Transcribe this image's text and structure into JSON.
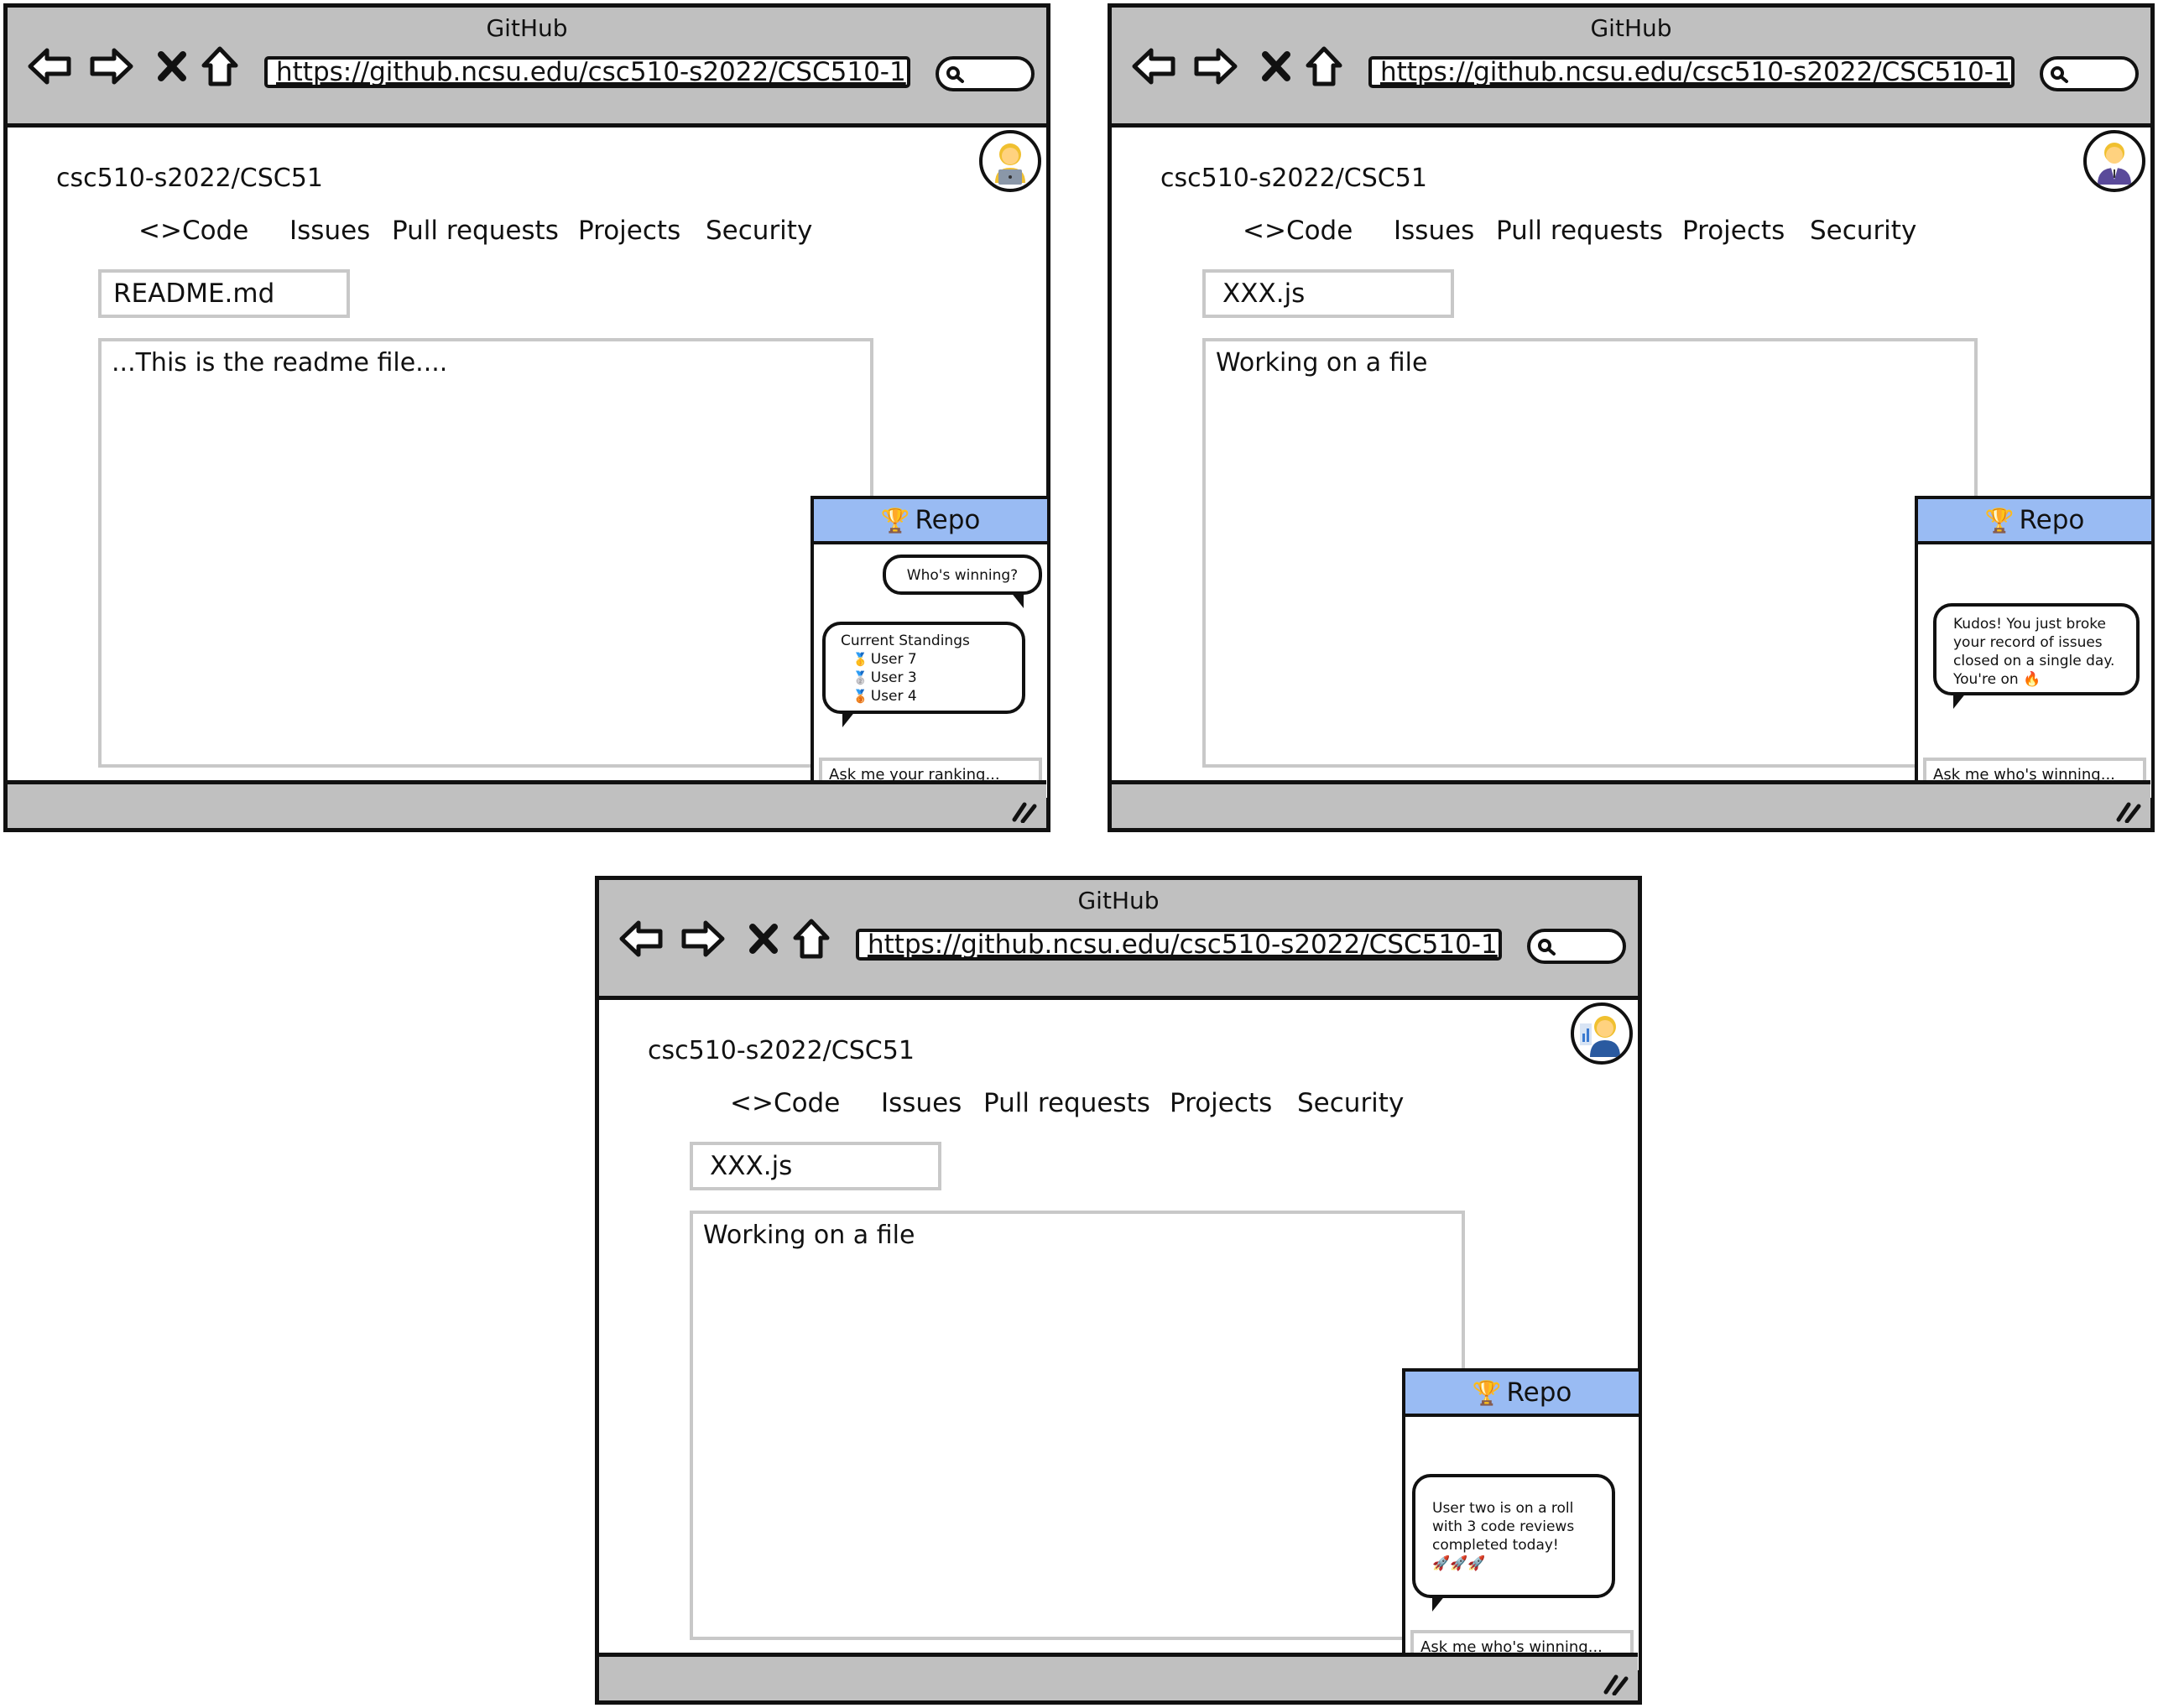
{
  "windows": [
    {
      "title": "GitHub",
      "url": "https://github.ncsu.edu/csc510-s2022/CSC510-1",
      "avatar_icon": "woman-technologist-icon",
      "repo": "csc510-s2022/CSC51",
      "tabs": [
        "<>Code",
        "Issues",
        "Pull requests",
        "Projects",
        "Security"
      ],
      "file_tab": "README.md",
      "content": "...This is the readme file....",
      "chat": {
        "header": "Repo",
        "user_message": "Who's winning?",
        "bot_title": "Current Standings",
        "standings": [
          "User 7",
          "User 3",
          "User 4"
        ],
        "input_placeholder": "Ask me your ranking..."
      }
    },
    {
      "title": "GitHub",
      "url": "https://github.ncsu.edu/csc510-s2022/CSC510-1",
      "avatar_icon": "man-office-worker-icon",
      "repo": "csc510-s2022/CSC51",
      "tabs": [
        "<>Code",
        "Issues",
        "Pull requests",
        "Projects",
        "Security"
      ],
      "file_tab": "XXX.js",
      "content": "Working on a file",
      "chat": {
        "header": "Repo",
        "bot_lines": [
          "Kudos! You just broke",
          "your record of issues",
          "closed on a single day.",
          "You're on"
        ],
        "input_placeholder": "Ask me who's winning..."
      }
    },
    {
      "title": "GitHub",
      "url": "https://github.ncsu.edu/csc510-s2022/CSC510-1",
      "avatar_icon": "woman-office-worker-icon",
      "repo": "csc510-s2022/CSC51",
      "tabs": [
        "<>Code",
        "Issues",
        "Pull requests",
        "Projects",
        "Security"
      ],
      "file_tab": "XXX.js",
      "content": "Working on a file",
      "chat": {
        "header": "Repo",
        "bot_lines": [
          "User two is on a roll",
          "with 3 code reviews",
          "completed today!"
        ],
        "input_placeholder": "Ask me who's winning..."
      }
    }
  ]
}
